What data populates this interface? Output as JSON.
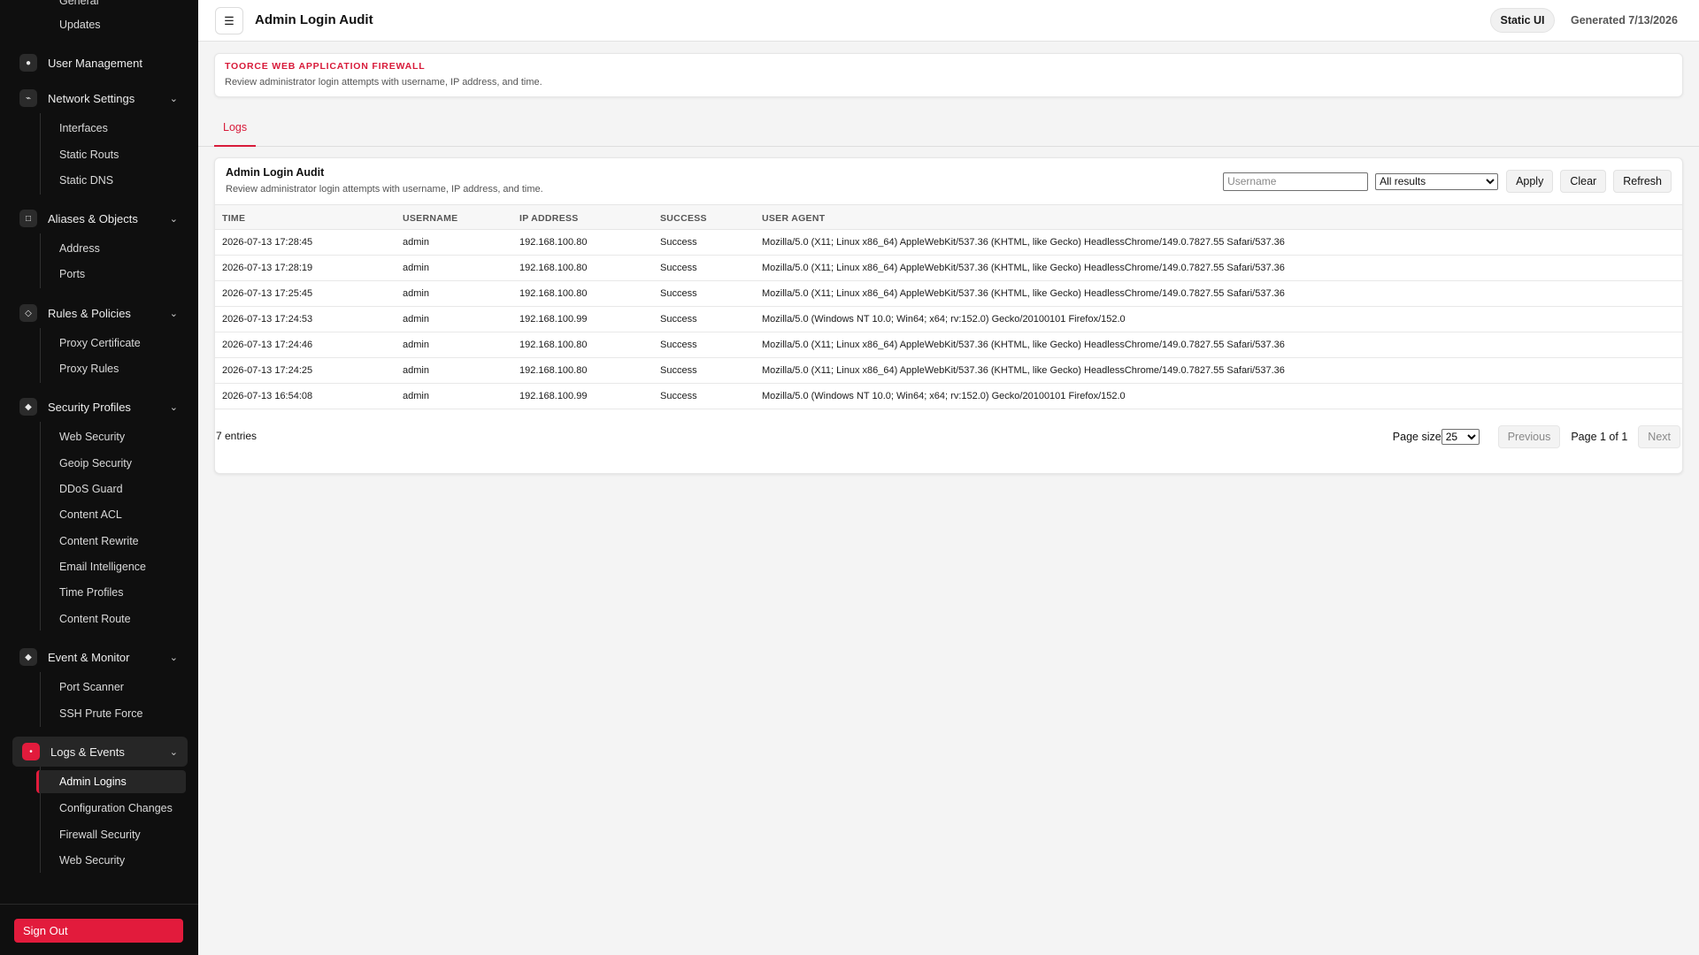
{
  "header": {
    "title": "Admin Login Audit",
    "badge": "Static UI",
    "generated": "Generated 7/13/2026",
    "menu_icon": "☰"
  },
  "banner": {
    "brand": "TOORCE WEB APPLICATION FIREWALL",
    "description": "Review administrator login attempts with username, IP address, and time."
  },
  "tabs": [
    "Logs"
  ],
  "sidebar": {
    "top_items": [
      "General",
      "Updates"
    ],
    "user_management": "User Management",
    "network_settings": {
      "label": "Network Settings",
      "items": [
        "Interfaces",
        "Static Routs",
        "Static DNS"
      ]
    },
    "aliases": {
      "label": "Aliases & Objects",
      "items": [
        "Address",
        "Ports"
      ]
    },
    "rules": {
      "label": "Rules & Policies",
      "items": [
        "Proxy Certificate",
        "Proxy Rules"
      ]
    },
    "security_profiles": {
      "label": "Security Profiles",
      "items": [
        "Web Security",
        "Geoip Security",
        "DDoS Guard",
        "Content ACL",
        "Content Rewrite",
        "Email Intelligence",
        "Time Profiles",
        "Content Route"
      ]
    },
    "event_monitor": {
      "label": "Event & Monitor",
      "items": [
        "Port Scanner",
        "SSH Prute Force"
      ]
    },
    "logs_events": {
      "label": "Logs & Events",
      "items": [
        "Admin Logins",
        "Configuration Changes",
        "Firewall Security",
        "Web Security"
      ]
    },
    "sign_out": "Sign Out"
  },
  "card": {
    "title": "Admin Login Audit",
    "description": "Review administrator login attempts with username, IP address, and time.",
    "username_placeholder": "Username",
    "result_filter": "All results",
    "apply": "Apply",
    "clear": "Clear",
    "refresh": "Refresh"
  },
  "table": {
    "columns": [
      "TIME",
      "USERNAME",
      "IP ADDRESS",
      "SUCCESS",
      "USER AGENT"
    ],
    "rows": [
      [
        "2026-07-13 17:28:45",
        "admin",
        "192.168.100.80",
        "Success",
        "Mozilla/5.0 (X11; Linux x86_64) AppleWebKit/537.36 (KHTML, like Gecko) HeadlessChrome/149.0.7827.55 Safari/537.36"
      ],
      [
        "2026-07-13 17:28:19",
        "admin",
        "192.168.100.80",
        "Success",
        "Mozilla/5.0 (X11; Linux x86_64) AppleWebKit/537.36 (KHTML, like Gecko) HeadlessChrome/149.0.7827.55 Safari/537.36"
      ],
      [
        "2026-07-13 17:25:45",
        "admin",
        "192.168.100.80",
        "Success",
        "Mozilla/5.0 (X11; Linux x86_64) AppleWebKit/537.36 (KHTML, like Gecko) HeadlessChrome/149.0.7827.55 Safari/537.36"
      ],
      [
        "2026-07-13 17:24:53",
        "admin",
        "192.168.100.99",
        "Success",
        "Mozilla/5.0 (Windows NT 10.0; Win64; x64; rv:152.0) Gecko/20100101 Firefox/152.0"
      ],
      [
        "2026-07-13 17:24:46",
        "admin",
        "192.168.100.80",
        "Success",
        "Mozilla/5.0 (X11; Linux x86_64) AppleWebKit/537.36 (KHTML, like Gecko) HeadlessChrome/149.0.7827.55 Safari/537.36"
      ],
      [
        "2026-07-13 17:24:25",
        "admin",
        "192.168.100.80",
        "Success",
        "Mozilla/5.0 (X11; Linux x86_64) AppleWebKit/537.36 (KHTML, like Gecko) HeadlessChrome/149.0.7827.55 Safari/537.36"
      ],
      [
        "2026-07-13 16:54:08",
        "admin",
        "192.168.100.99",
        "Success",
        "Mozilla/5.0 (Windows NT 10.0; Win64; x64; rv:152.0) Gecko/20100101 Firefox/152.0"
      ]
    ]
  },
  "footer": {
    "entries": "7 entries",
    "page_size_label": "Page size",
    "page_size": "25",
    "previous": "Previous",
    "page_info": "Page 1 of 1",
    "next": "Next"
  },
  "colors": {
    "accent": "#e21b3c",
    "sidebar_bg": "#0f0f0f"
  },
  "icons": {
    "user_management": "user-icon",
    "network_settings": "network-icon",
    "aliases": "object-icon",
    "rules": "rules-icon",
    "security_profiles": "shield-icon",
    "event_monitor": "monitor-icon",
    "logs_events": "logs-icon",
    "chevron": "chevron-down-icon"
  }
}
